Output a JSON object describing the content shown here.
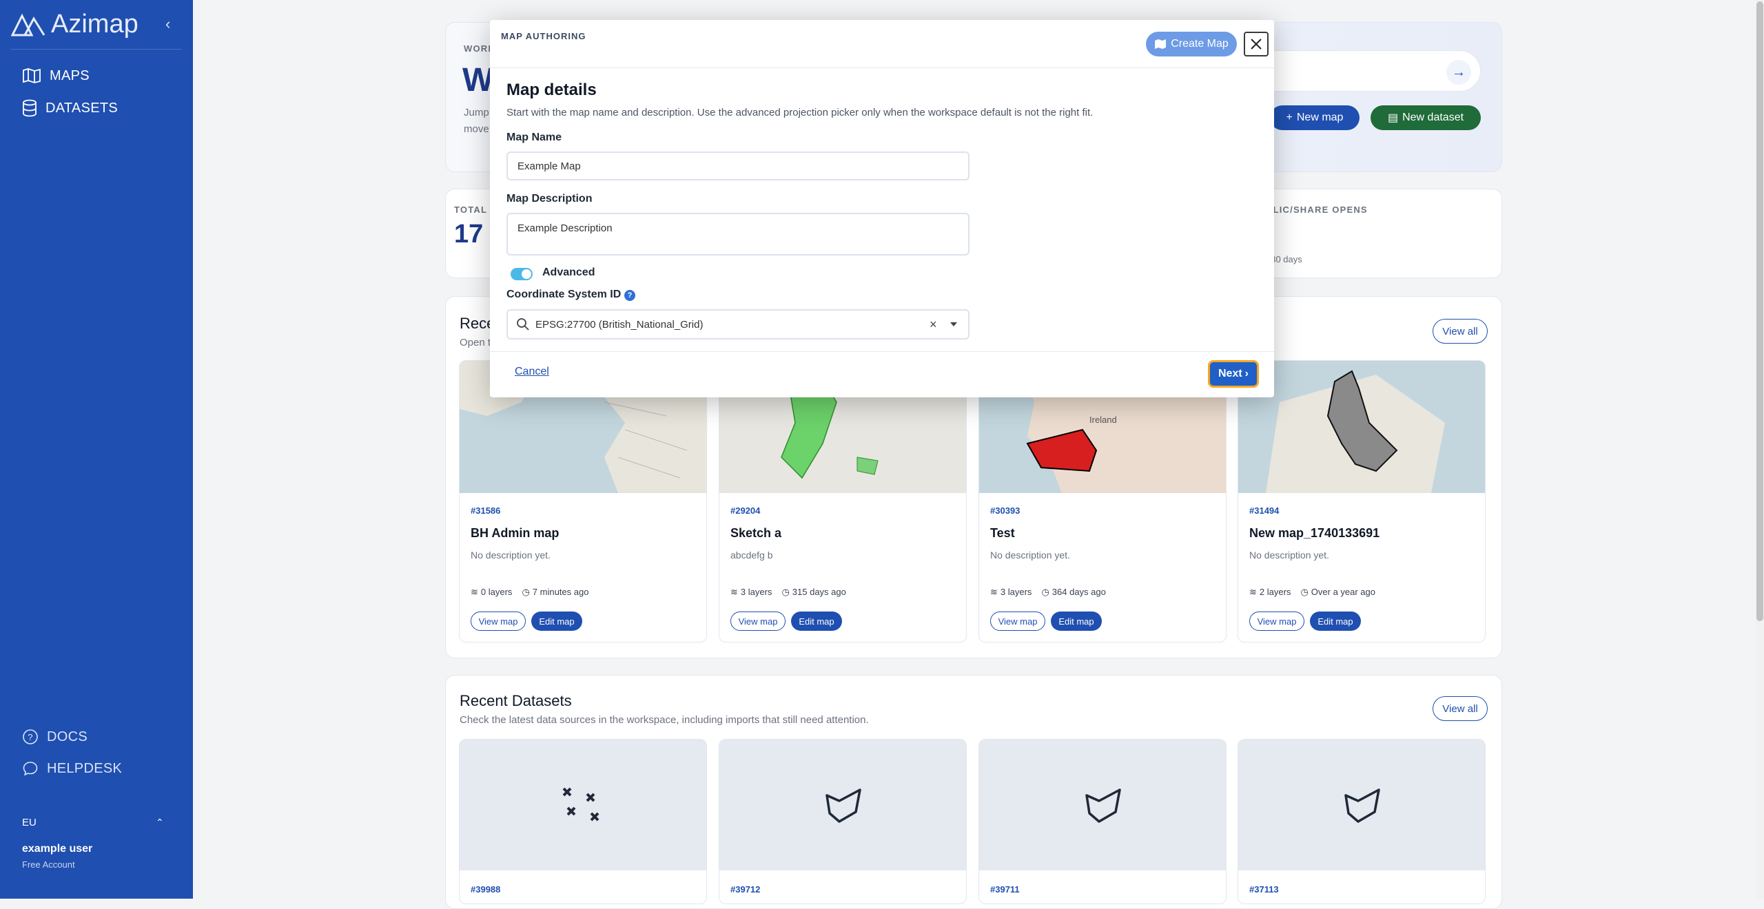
{
  "sidebar": {
    "brand": "Azimap",
    "nav": [
      {
        "label": "MAPS",
        "icon": "map-icon"
      },
      {
        "label": "DATASETS",
        "icon": "database-icon"
      }
    ],
    "bottom_nav": [
      {
        "label": "DOCS",
        "icon": "question-circle-icon"
      },
      {
        "label": "HELPDESK",
        "icon": "chat-icon"
      }
    ],
    "region": "EU",
    "user_name": "example user",
    "plan": "Free Account"
  },
  "hero": {
    "eyebrow": "WORK",
    "title": "W",
    "line1": "Jump",
    "line2": "move",
    "new_map": "New map",
    "new_dataset": "New dataset"
  },
  "stats": {
    "left_label": "TOTAL",
    "left_value": "17",
    "right_label": "BLIC/SHARE OPENS",
    "right_sub": "t 30 days"
  },
  "recent_maps": {
    "title": "Rece",
    "subtitle": "Open t",
    "view_all": "View all",
    "cards": [
      {
        "id": "#31586",
        "name": "BH Admin map",
        "desc": "No description yet.",
        "layers": "0 layers",
        "time": "7 minutes ago",
        "view": "View map",
        "edit": "Edit map"
      },
      {
        "id": "#29204",
        "name": "Sketch a",
        "desc": "abcdefg b",
        "layers": "3 layers",
        "time": "315 days ago",
        "view": "View map",
        "edit": "Edit map"
      },
      {
        "id": "#30393",
        "name": "Test",
        "desc": "No description yet.",
        "layers": "3 layers",
        "time": "364 days ago",
        "view": "View map",
        "edit": "Edit map"
      },
      {
        "id": "#31494",
        "name": "New map_1740133691",
        "desc": "No description yet.",
        "layers": "2 layers",
        "time": "Over a year ago",
        "view": "View map",
        "edit": "Edit map"
      }
    ],
    "thumb_label_ireland": "Ireland"
  },
  "recent_datasets": {
    "title": "Recent Datasets",
    "subtitle": "Check the latest data sources in the workspace, including imports that still need attention.",
    "view_all": "View all",
    "cards": [
      {
        "id": "#39988",
        "icon": "points-icon"
      },
      {
        "id": "#39712",
        "icon": "polygon-icon"
      },
      {
        "id": "#39711",
        "icon": "polygon-icon"
      },
      {
        "id": "#37113",
        "icon": "polygon-icon"
      }
    ]
  },
  "modal": {
    "eyebrow": "MAP AUTHORING",
    "create_label": "Create Map",
    "title": "Map details",
    "subtitle": "Start with the map name and description. Use the advanced projection picker only when the workspace default is not the right fit.",
    "name_label": "Map Name",
    "name_value": "Example Map",
    "desc_label": "Map Description",
    "desc_value": "Example Description",
    "advanced_label": "Advanced",
    "advanced_on": true,
    "crs_label": "Coordinate System ID",
    "crs_value": "EPSG:27700 (British_National_Grid)",
    "cancel_label": "Cancel",
    "next_label": "Next"
  },
  "colors": {
    "sidebar": "#1f4fb0",
    "primary": "#1f4fb0",
    "dataset_green": "#1f6b3a",
    "focus_ring": "#f5a623"
  }
}
